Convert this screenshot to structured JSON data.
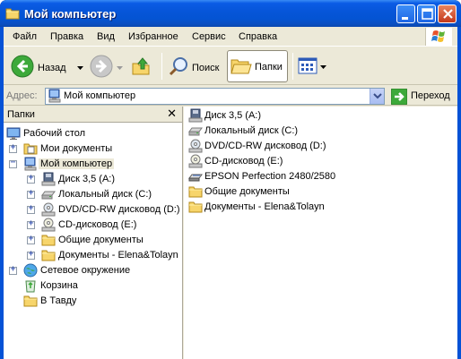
{
  "window": {
    "title": "Мой компьютер"
  },
  "menu": [
    "Файл",
    "Правка",
    "Вид",
    "Избранное",
    "Сервис",
    "Справка"
  ],
  "toolbar": {
    "back": "Назад",
    "search": "Поиск",
    "folders": "Папки"
  },
  "address": {
    "label": "Адрес:",
    "value": "Мой компьютер",
    "go": "Переход"
  },
  "folder_pane": {
    "title": "Папки",
    "tree": [
      {
        "label": "Рабочий стол",
        "icon": "desktop-icon"
      },
      {
        "label": "Мои документы",
        "icon": "my-documents-icon"
      },
      {
        "label": "Мой компьютер",
        "icon": "my-computer-icon"
      },
      {
        "label": "Диск 3,5 (A:)",
        "icon": "floppy-drive-icon"
      },
      {
        "label": "Локальный диск (C:)",
        "icon": "hard-drive-icon"
      },
      {
        "label": "DVD/CD-RW дисковод (D:)",
        "icon": "dvd-drive-icon"
      },
      {
        "label": "CD-дисковод (E:)",
        "icon": "cd-drive-icon"
      },
      {
        "label": "Общие документы",
        "icon": "folder-icon"
      },
      {
        "label": "Документы - Elena&Tolayn",
        "icon": "folder-icon"
      },
      {
        "label": "Сетевое окружение",
        "icon": "network-icon"
      },
      {
        "label": "Корзина",
        "icon": "recycle-bin-icon"
      },
      {
        "label": "В Тавду",
        "icon": "folder-icon"
      }
    ]
  },
  "files": [
    {
      "label": "Диск 3,5 (A:)",
      "icon": "floppy-drive-icon"
    },
    {
      "label": "Локальный диск (C:)",
      "icon": "hard-drive-icon"
    },
    {
      "label": "DVD/CD-RW дисковод (D:)",
      "icon": "dvd-drive-icon"
    },
    {
      "label": "CD-дисковод (E:)",
      "icon": "cd-drive-icon"
    },
    {
      "label": "EPSON Perfection 2480/2580",
      "icon": "scanner-icon"
    },
    {
      "label": "Общие документы",
      "icon": "folder-icon"
    },
    {
      "label": "Документы - Elena&Tolayn",
      "icon": "folder-icon"
    }
  ]
}
